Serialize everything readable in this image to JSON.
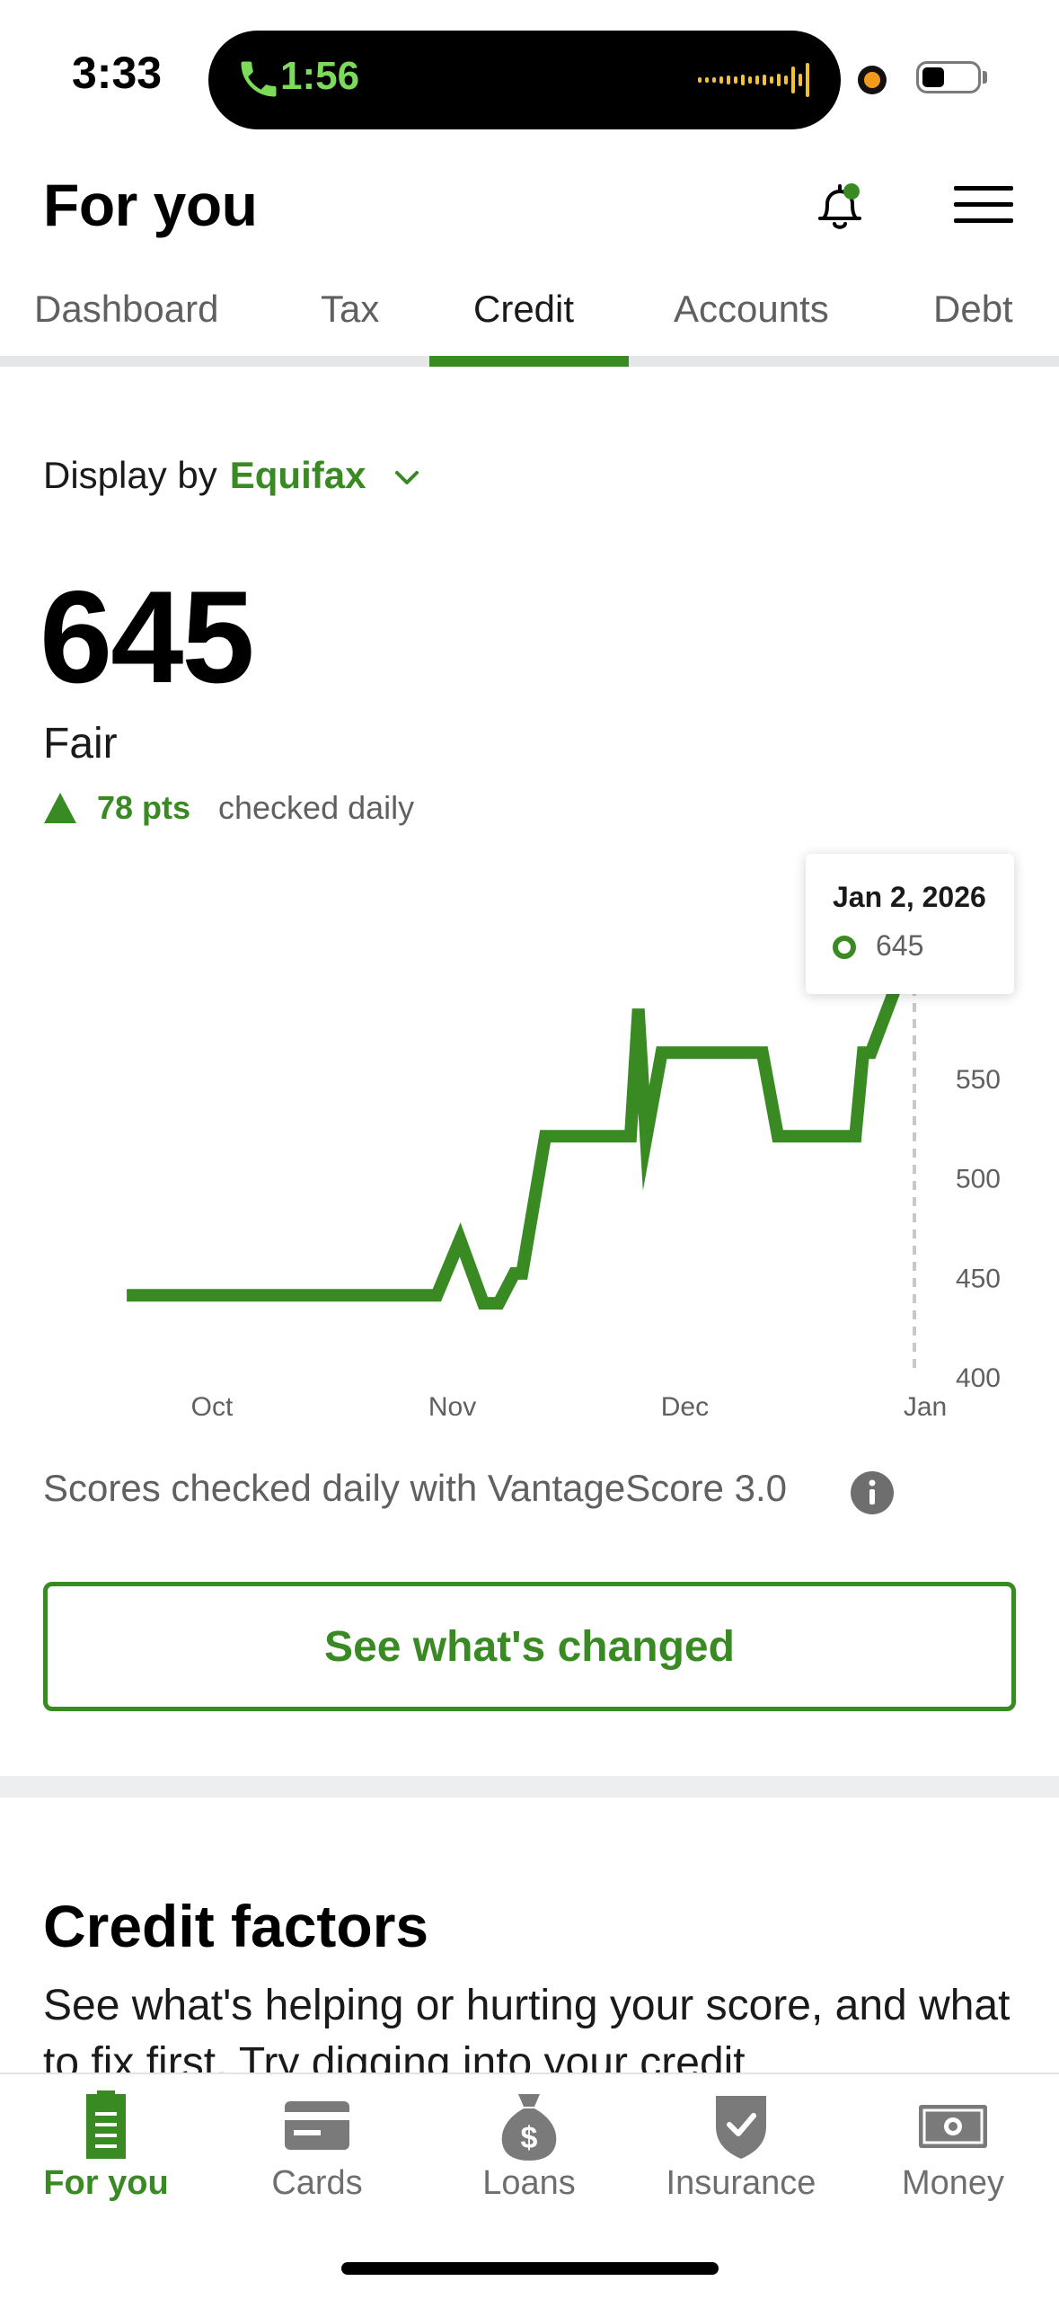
{
  "status_bar": {
    "time": "3:33",
    "call_duration": "1:56"
  },
  "header": {
    "title": "For you"
  },
  "tabs": [
    {
      "label": "Dashboard",
      "active": false
    },
    {
      "label": "Tax",
      "active": false
    },
    {
      "label": "Credit",
      "active": true
    },
    {
      "label": "Accounts",
      "active": false
    },
    {
      "label": "Debt",
      "active": false
    }
  ],
  "credit": {
    "display_by_label": "Display by",
    "bureau": "Equifax",
    "score": "645",
    "rating": "Fair",
    "change_points": "78 pts",
    "change_note": "checked daily",
    "tooltip": {
      "date": "Jan 2, 2026",
      "value": "645"
    },
    "disclaimer": "Scores checked daily with VantageScore 3.0",
    "cta_label": "See what's changed"
  },
  "chart_data": {
    "type": "line",
    "title": "",
    "xlabel": "",
    "ylabel": "",
    "x_ticks": [
      "Oct",
      "Nov",
      "Dec",
      "Jan"
    ],
    "y_ticks": [
      400,
      450,
      500,
      550
    ],
    "ylim": [
      400,
      650
    ],
    "grid": false,
    "legend": "none",
    "color": "#3a8a24",
    "series": [
      {
        "x": [
          "2025-09-20",
          "2025-10-30",
          "2025-11-02",
          "2025-11-05",
          "2025-11-07",
          "2025-11-09",
          "2025-11-10",
          "2025-11-13",
          "2025-11-17",
          "2025-11-24",
          "2025-11-25",
          "2025-11-26",
          "2025-11-28",
          "2025-12-02",
          "2025-12-11",
          "2025-12-13",
          "2025-12-23",
          "2025-12-24",
          "2025-12-25",
          "2026-01-02"
        ],
        "y": [
          441,
          441,
          469,
          437,
          437,
          452,
          452,
          521,
          521,
          521,
          585,
          520,
          563,
          563,
          563,
          521,
          521,
          563,
          563,
          645
        ]
      }
    ]
  },
  "factors": {
    "title": "Credit factors",
    "body": "See what's helping or hurting your score, and what to fix first. Try digging into your credit"
  },
  "bottom_nav": [
    {
      "label": "For you",
      "icon": "document-icon",
      "active": true
    },
    {
      "label": "Cards",
      "icon": "card-icon",
      "active": false
    },
    {
      "label": "Loans",
      "icon": "money-bag-icon",
      "active": false
    },
    {
      "label": "Insurance",
      "icon": "shield-icon",
      "active": false
    },
    {
      "label": "Money",
      "icon": "banknote-icon",
      "active": false
    }
  ]
}
